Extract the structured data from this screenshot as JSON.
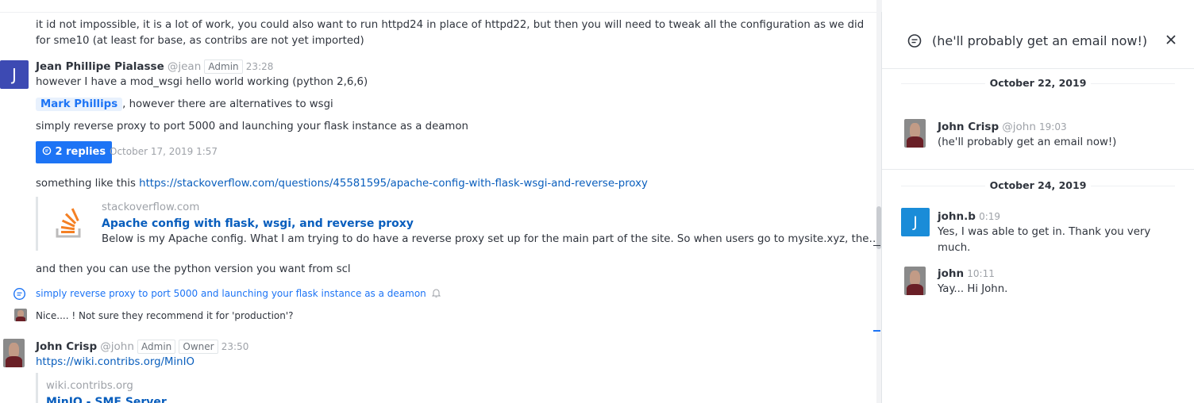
{
  "chat": {
    "msg0": {
      "line1": "it id not impossible, it is a lot of work, you could also want to run httpd24 in place of httpd22, but then you will need to tweak all the configuration as we did",
      "line2": "for sme10 (at least for base, as contribs are not yet imported)"
    },
    "msg1": {
      "avatar_letter": "J",
      "name": "Jean Phillipe Pialasse",
      "handle": "@jean",
      "role": "Admin",
      "time": "23:28",
      "text1": "however I have a mod_wsgi hello world working (python 2,6,6)",
      "mention": "Mark Phillips",
      "text2": ", however there are alternatives to wsgi",
      "text3": "simply reverse proxy to port 5000 and launching your flask instance as a deamon",
      "replies_label": "2 replies",
      "replies_time": "October 17, 2019 1:57",
      "text4_prefix": "something like this ",
      "link": "https://stackoverflow.com/questions/45581595/apache-config-with-flask-wsgi-and-reverse-proxy",
      "preview_site": "stackoverflow.com",
      "preview_title": "Apache config with flask, wsgi, and reverse proxy",
      "preview_desc": "Below is my Apache config. What I am trying to do have a reverse proxy set up for the main part of the site. So when users go to mysite.xyz, the…",
      "text5": "and then you can use the python version you want from scl"
    },
    "thread_ref": {
      "text": "simply reverse proxy to port 5000 and launching your flask instance as a deamon",
      "reply": "Nice.... ! Not sure they recommend it for 'production'?"
    },
    "msg2": {
      "name": "John Crisp",
      "handle": "@john",
      "role1": "Admin",
      "role2": "Owner",
      "time": "23:50",
      "link": "https://wiki.contribs.org/MinIO",
      "preview_site": "wiki.contribs.org",
      "preview_title": "MinIO - SME Server"
    }
  },
  "thread_panel": {
    "title": "(he'll probably get an email now!)",
    "groups": [
      {
        "date": "October 22, 2019",
        "messages": [
          {
            "name": "John Crisp",
            "handle": "@john",
            "time": "19:03",
            "text": "(he'll probably get an email now!)"
          }
        ]
      },
      {
        "date": "October 24, 2019",
        "messages": [
          {
            "avatar_letter": "J",
            "name": "john.b",
            "time": "0:19",
            "text1": "Yes, I was able to get in. Thank you very",
            "text2": "much."
          },
          {
            "name": "john",
            "time": "10:11",
            "text": "Yay... Hi John."
          }
        ]
      }
    ]
  },
  "colors": {
    "accent": "#1d74f5",
    "link": "#095ebd",
    "avatar_blue": "#3d4ab3",
    "avatar_light_blue": "#1a8cd8"
  },
  "icons": [
    "thread-icon",
    "close-icon",
    "stackoverflow-logo",
    "bell-icon"
  ]
}
